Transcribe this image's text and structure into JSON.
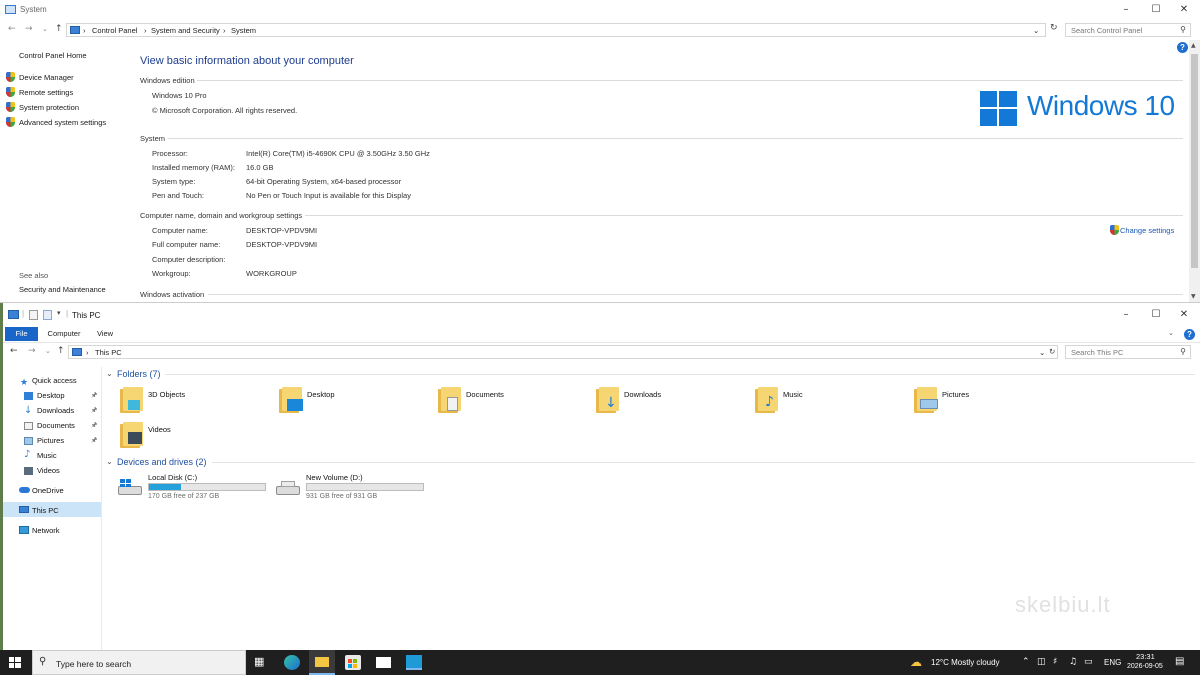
{
  "system_window": {
    "title": "System",
    "breadcrumbs": [
      "Control Panel",
      "System and Security",
      "System"
    ],
    "search_placeholder": "Search Control Panel",
    "left_nav": {
      "home": "Control Panel Home",
      "links": [
        "Device Manager",
        "Remote settings",
        "System protection",
        "Advanced system settings"
      ],
      "see_also_heading": "See also",
      "see_also_links": [
        "Security and Maintenance"
      ]
    },
    "heading": "View basic information about your computer",
    "edition": {
      "heading": "Windows edition",
      "name": "Windows 10 Pro",
      "copyright": "© Microsoft Corporation. All rights reserved."
    },
    "logo_text": "Windows 10",
    "system": {
      "heading": "System",
      "rows": [
        {
          "label": "Processor:",
          "value": "Intel(R) Core(TM) i5-4690K CPU @ 3.50GHz   3.50 GHz"
        },
        {
          "label": "Installed memory (RAM):",
          "value": "16.0 GB"
        },
        {
          "label": "System type:",
          "value": "64-bit Operating System, x64-based processor"
        },
        {
          "label": "Pen and Touch:",
          "value": "No Pen or Touch Input is available for this Display"
        }
      ]
    },
    "computer_name": {
      "heading": "Computer name, domain and workgroup settings",
      "change_settings": "Change settings",
      "rows": [
        {
          "label": "Computer name:",
          "value": "DESKTOP-VPDV9MI"
        },
        {
          "label": "Full computer name:",
          "value": "DESKTOP-VPDV9MI"
        },
        {
          "label": "Computer description:",
          "value": ""
        },
        {
          "label": "Workgroup:",
          "value": "WORKGROUP"
        }
      ]
    },
    "activation_heading": "Windows activation"
  },
  "explorer_window": {
    "title": "This PC",
    "ribbon_tabs": [
      "File",
      "Computer",
      "View"
    ],
    "address": "This PC",
    "search_placeholder": "Search This PC",
    "nav": {
      "quick_access": "Quick access",
      "quick_items": [
        "Desktop",
        "Downloads",
        "Documents",
        "Pictures",
        "Music",
        "Videos"
      ],
      "onedrive": "OneDrive",
      "this_pc": "This PC",
      "network": "Network"
    },
    "folders_heading": "Folders (7)",
    "folders": [
      "3D Objects",
      "Desktop",
      "Documents",
      "Downloads",
      "Music",
      "Pictures",
      "Videos"
    ],
    "drives_heading": "Devices and drives (2)",
    "drives": [
      {
        "name": "Local Disk (C:)",
        "free": "170 GB free of 237 GB",
        "used_fraction": 0.28
      },
      {
        "name": "New Volume (D:)",
        "free": "931 GB free of 931 GB",
        "used_fraction": 0.0
      }
    ]
  },
  "taskbar": {
    "search_placeholder": "Type here to search",
    "weather": "12°C  Mostly cloudy",
    "language": "ENG",
    "time": "23:31",
    "date": "2026-09-05"
  },
  "watermark": "skelbiu.lt"
}
